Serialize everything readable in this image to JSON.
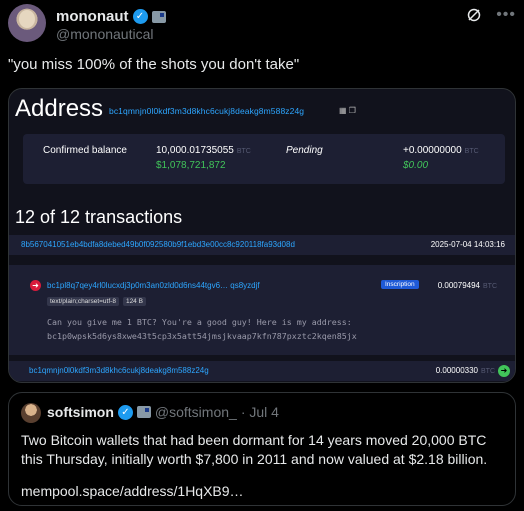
{
  "post": {
    "name": "mononaut",
    "handle": "@mononautical",
    "text": "\"you miss 100% of the shots you don't take\""
  },
  "card": {
    "address_title": "Address",
    "address_hash": "bc1qmnjn0l0kdf3m3d8khc6cukj8deakg8m588z24g",
    "confirmed_label": "Confirmed balance",
    "confirmed_btc": "10,000.01735055",
    "confirmed_usd": "$1,078,721,872",
    "pending_label": "Pending",
    "pending_btc": "+0.00000000",
    "pending_usd": "$0.00",
    "btc_unit": "BTC",
    "tx_count": "12 of 12 transactions",
    "tx_hash": "8b567041051eb4bdfa8debed49b0f092580b9f1ebd3e00cc8c920118fa93d08d",
    "tx_date": "2025-07-04 14:03:16",
    "input_address": "bc1pl8q7qey4rl0lucxdj3p0m3an0zld0d6ns44tgv6…   qs8yzdjf",
    "inscription_label": "Inscription",
    "input_value": "0.00079494",
    "tag_mime": "text/plain;charset=utf-8",
    "tag_size": "124 B",
    "message_line1": "Can you give me 1 BTC? You're a good guy! Here is my address:",
    "message_line2": "bc1p0wpsk5d6ys8xwe43t5cp3x5att54jmsjkvaap7kfn787pxztc2kqen85jx",
    "output_address": "bc1qmnjn0l0kdf3m3d8khc6cukj8deakg8m588z24g",
    "output_value": "0.00000330"
  },
  "quote": {
    "name": "softsimon",
    "handle": "@softsimon_",
    "date": "· Jul 4",
    "text": "Two Bitcoin wallets that had been dormant for 14 years moved 20,000 BTC this Thursday, initially worth $7,800 in 2011 and now valued at $2.18 billion.",
    "link": "mempool.space/address/1HqXB9…"
  },
  "icons": {
    "verified": "verified-check-icon",
    "grok": "grok-icon",
    "more": "more-icon"
  },
  "colors": {
    "accent_blue": "#2da6ff",
    "green": "#41c45a",
    "red": "#d81b3c",
    "card_bg": "#11121c",
    "panel_bg": "#1d1f33"
  }
}
